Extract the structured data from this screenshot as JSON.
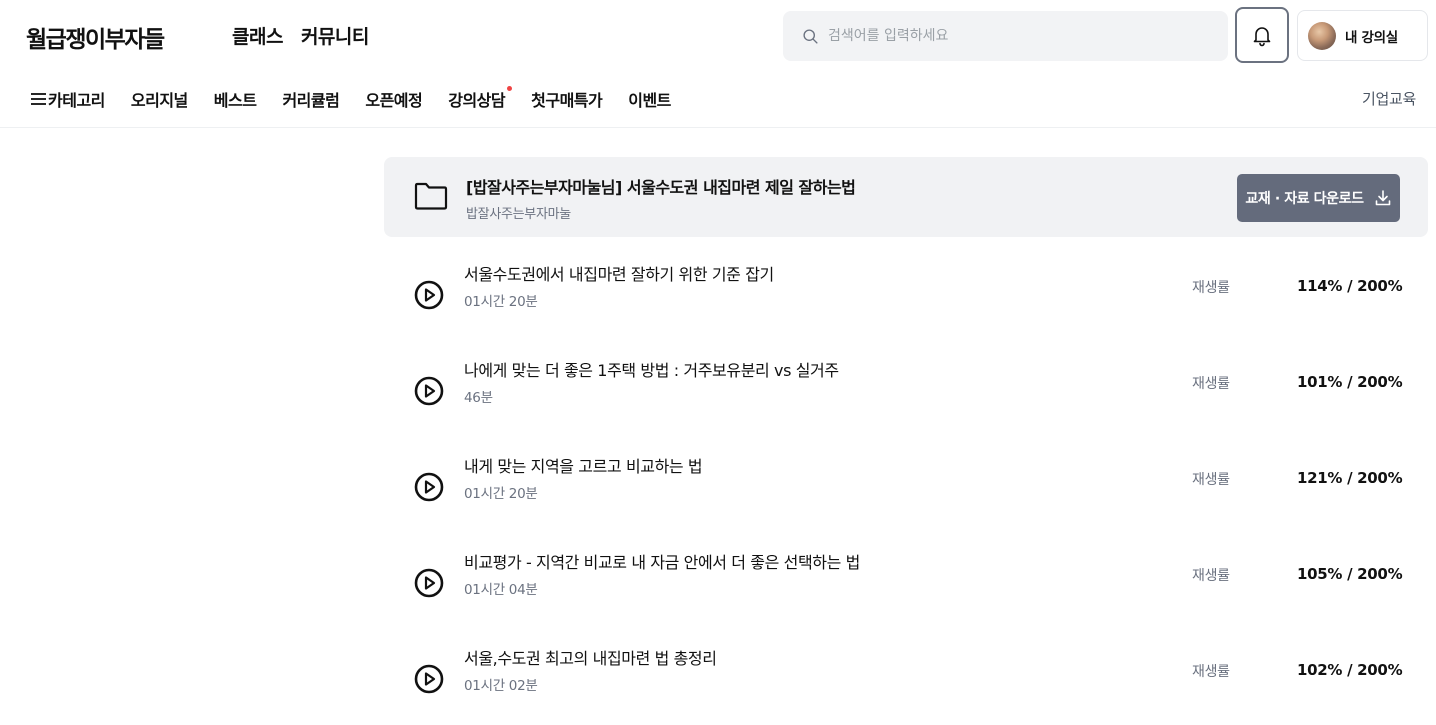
{
  "header": {
    "logo": "월급쟁이부자들",
    "nav": [
      "클래스",
      "커뮤니티"
    ],
    "search_placeholder": "검색어를 입력하세요",
    "my_lectures_label": "내 강의실",
    "icons": {
      "search": "search-icon",
      "bell": "bell-icon",
      "avatar": "avatar"
    }
  },
  "subnav": {
    "items": [
      "카테고리",
      "오리지널",
      "베스트",
      "커리큘럼",
      "오픈예정",
      "강의상담",
      "첫구매특가",
      "이벤트"
    ],
    "right_link": "기업교육",
    "notification_dot_color": "#ef4444"
  },
  "course": {
    "title": "[밥잘사주는부자마눌님] 서울수도권 내집마련 제일 잘하는법",
    "author": "밥잘사주는부자마눌",
    "download_label": "교재 · 자료 다운로드",
    "download_button_color": "#646b7c"
  },
  "lessons": [
    {
      "title": "서울수도권에서 내집마련 잘하기 위한 기준 잡기",
      "duration": "01시간 20분",
      "rate_label": "재생률",
      "rate": "114% / 200%"
    },
    {
      "title": "나에게 맞는 더 좋은 1주택 방법 : 거주보유분리 vs 실거주",
      "duration": "46분",
      "rate_label": "재생률",
      "rate": "101% / 200%"
    },
    {
      "title": "내게 맞는 지역을 고르고 비교하는 법",
      "duration": "01시간 20분",
      "rate_label": "재생률",
      "rate": "121% / 200%"
    },
    {
      "title": "비교평가 - 지역간 비교로 내 자금 안에서 더 좋은 선택하는 법",
      "duration": "01시간 04분",
      "rate_label": "재생률",
      "rate": "105% / 200%"
    },
    {
      "title": "서울,수도권 최고의 내집마련 법 총정리",
      "duration": "01시간 02분",
      "rate_label": "재생률",
      "rate": "102% / 200%"
    }
  ]
}
